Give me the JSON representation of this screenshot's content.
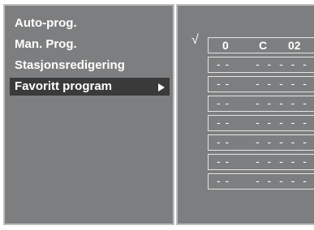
{
  "menu": {
    "items": [
      {
        "label": "Auto-prog."
      },
      {
        "label": "Man. Prog."
      },
      {
        "label": "Stasjonsredigering"
      },
      {
        "label": "Favoritt program",
        "selected": true
      }
    ]
  },
  "favorites": {
    "check_mark": "√",
    "slots": [
      {
        "number": "0",
        "source": "C",
        "channel": "02"
      },
      {
        "empty_left": "- -",
        "empty_right": "- - - - -"
      },
      {
        "empty_left": "- -",
        "empty_right": "- - - - -"
      },
      {
        "empty_left": "- -",
        "empty_right": "- - - - -"
      },
      {
        "empty_left": "- -",
        "empty_right": "- - - - -"
      },
      {
        "empty_left": "- -",
        "empty_right": "- - - - -"
      },
      {
        "empty_left": "- -",
        "empty_right": "- - - - -"
      },
      {
        "empty_left": "- -",
        "empty_right": "- - - - -"
      }
    ]
  },
  "colors": {
    "panel": "#7d7e7f",
    "selected": "#3a3a3a",
    "text": "#ffffff",
    "border": "#bebebe"
  }
}
